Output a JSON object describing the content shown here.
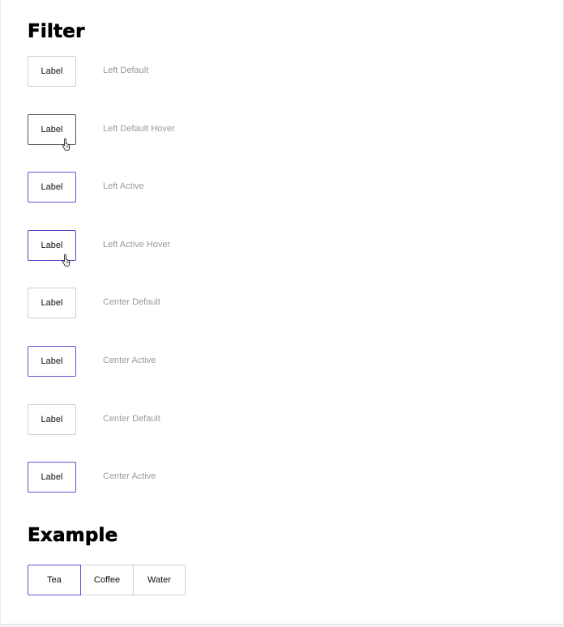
{
  "sections": {
    "filter_title": "Filter",
    "example_title": "Example"
  },
  "filter_states": [
    {
      "label": "Label",
      "desc": "Left Default",
      "state": "default",
      "hover": false
    },
    {
      "label": "Label",
      "desc": "Left Default Hover",
      "state": "default",
      "hover": true
    },
    {
      "label": "Label",
      "desc": "Left Active",
      "state": "active",
      "hover": false
    },
    {
      "label": "Label",
      "desc": "Left Active Hover",
      "state": "active",
      "hover": true
    },
    {
      "label": "Label",
      "desc": "Center Default",
      "state": "default",
      "hover": false
    },
    {
      "label": "Label",
      "desc": "Center Active",
      "state": "active",
      "hover": false
    },
    {
      "label": "Label",
      "desc": "Center Default",
      "state": "default",
      "hover": false
    },
    {
      "label": "Label",
      "desc": "Center Active",
      "state": "active",
      "hover": false
    }
  ],
  "example": {
    "options": [
      {
        "label": "Tea",
        "active": true
      },
      {
        "label": "Coffee",
        "active": false
      },
      {
        "label": "Water",
        "active": false
      }
    ]
  },
  "icons": {
    "hover_cursor": "hand-pointer-icon"
  },
  "colors": {
    "active_border": "#6b4fd1",
    "default_border": "#cfcfcf",
    "hover_border": "#555555",
    "description_text": "#9b9b9b"
  }
}
